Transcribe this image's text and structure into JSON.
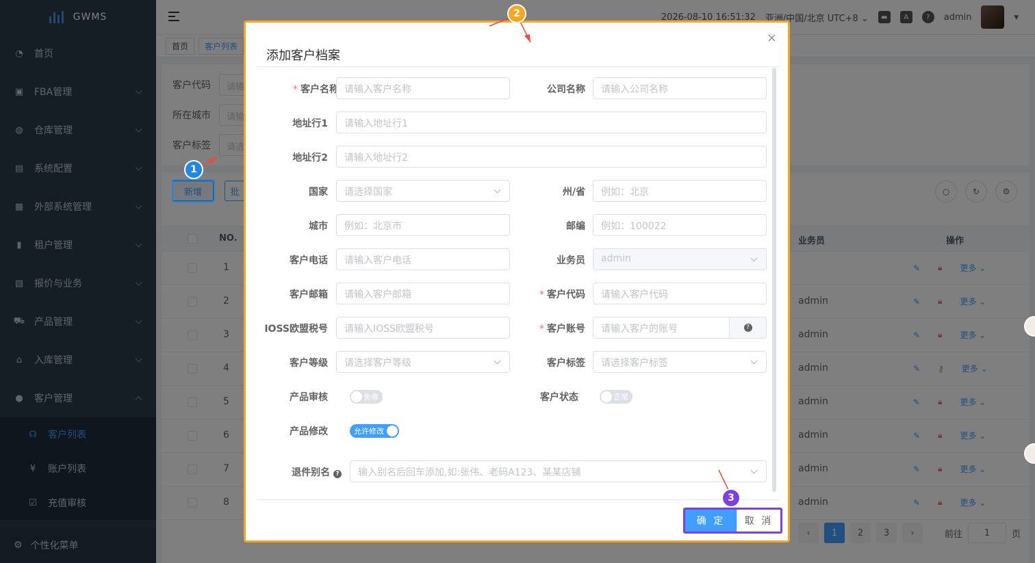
{
  "sidebar": {
    "brand": "GWMS",
    "items": [
      {
        "label": "首页",
        "icon": "dashboard-icon"
      },
      {
        "label": "FBA管理",
        "icon": "box-icon"
      },
      {
        "label": "仓库管理",
        "icon": "warehouse-icon"
      },
      {
        "label": "系统配置",
        "icon": "settings-icon"
      },
      {
        "label": "外部系统管理",
        "icon": "grid-icon"
      },
      {
        "label": "租户管理",
        "icon": "bar-chart-icon"
      },
      {
        "label": "报价与业务",
        "icon": "quote-icon"
      },
      {
        "label": "产品管理",
        "icon": "cart-icon"
      },
      {
        "label": "入库管理",
        "icon": "home-icon"
      },
      {
        "label": "客户管理",
        "icon": "user-icon"
      }
    ],
    "sub_items": [
      {
        "label": "客户列表",
        "icon": "customer-icon",
        "glyph": "☊"
      },
      {
        "label": "账户列表",
        "icon": "yen-icon",
        "glyph": "¥"
      },
      {
        "label": "充值审核",
        "icon": "check-box-icon",
        "glyph": "☑"
      }
    ],
    "footer": "个性化菜单"
  },
  "header": {
    "datetime": "2026-08-10 16:51:32",
    "timezone": "亚洲/中国/北京 UTC+8",
    "username": "admin"
  },
  "tags": [
    "首页",
    "客户列表"
  ],
  "search": {
    "fields": [
      {
        "label": "客户代码",
        "placeholder": "请输"
      },
      {
        "label": "所在城市",
        "placeholder": "请输"
      },
      {
        "label": "客户标签",
        "placeholder": "请选"
      }
    ]
  },
  "table": {
    "add_button": "新增",
    "batch_button": "批",
    "columns": {
      "no": "NO.",
      "sales": "业务员",
      "ops": "操作"
    },
    "rows": [
      {
        "no": "1",
        "sales": ""
      },
      {
        "no": "2",
        "sales": "admin"
      },
      {
        "no": "3",
        "sales": "admin"
      },
      {
        "no": "4",
        "sales": "admin"
      },
      {
        "no": "5",
        "sales": "admin"
      },
      {
        "no": "6",
        "sales": "admin"
      },
      {
        "no": "7",
        "sales": "admin"
      },
      {
        "no": "8",
        "sales": "admin"
      }
    ],
    "more_label": "更多",
    "pages": [
      "1",
      "2",
      "3"
    ],
    "goto_label": "前往",
    "goto_value": "1",
    "page_unit": "页"
  },
  "dialog": {
    "title": "添加客户档案",
    "fields": {
      "customer_name": {
        "label": "客户名称",
        "placeholder": "请输入客户名称"
      },
      "company_name": {
        "label": "公司名称",
        "placeholder": "请输入公司名称"
      },
      "address1": {
        "label": "地址行1",
        "placeholder": "请输入地址行1"
      },
      "address2": {
        "label": "地址行2",
        "placeholder": "请输入地址行2"
      },
      "country": {
        "label": "国家",
        "placeholder": "请选择国家"
      },
      "state": {
        "label": "州/省",
        "placeholder": "例如：北京"
      },
      "city": {
        "label": "城市",
        "placeholder": "例如：北京市"
      },
      "zip": {
        "label": "邮编",
        "placeholder": "例如：100022"
      },
      "phone": {
        "label": "客户电话",
        "placeholder": "请输入客户电话"
      },
      "salesperson": {
        "label": "业务员",
        "value": "admin"
      },
      "email": {
        "label": "客户邮箱",
        "placeholder": "请输入客户邮箱"
      },
      "customer_code": {
        "label": "客户代码",
        "placeholder": "请输入客户代码"
      },
      "ioss": {
        "label": "IOSS欧盟税号",
        "placeholder": "请输入IOSS欧盟税号"
      },
      "account": {
        "label": "客户账号",
        "placeholder": "请输入客户的账号"
      },
      "level": {
        "label": "客户等级",
        "placeholder": "请选择客户等级"
      },
      "customer_tag": {
        "label": "客户标签",
        "placeholder": "请选择客户标签"
      },
      "product_review": {
        "label": "产品审核",
        "switch_text": "免审"
      },
      "customer_status": {
        "label": "客户状态",
        "switch_text": "正常"
      },
      "product_modify": {
        "label": "产品修改",
        "switch_text": "允许修改"
      },
      "return_alias": {
        "label": "退件别名",
        "placeholder": "输入别名后回车添加,如:张伟、老码A123、某某店铺"
      }
    },
    "confirm": "确 定",
    "cancel": "取 消"
  },
  "annotations": {
    "badge1": "1",
    "badge2": "2",
    "badge3": "3"
  },
  "colors": {
    "sidebar_bg": "#2b3a4a",
    "accent": "#409eff",
    "highlight_orange": "#f5a623",
    "highlight_purple": "#7b3fe4"
  }
}
